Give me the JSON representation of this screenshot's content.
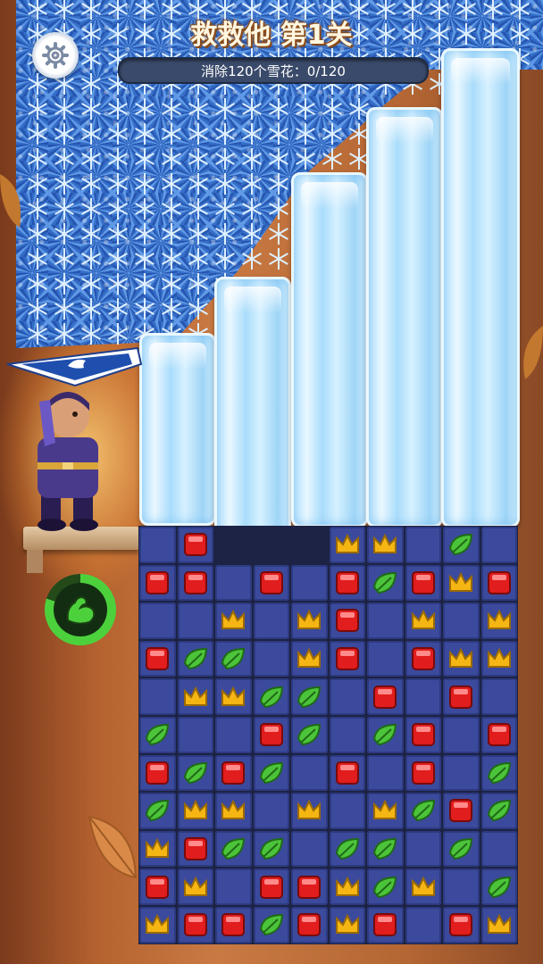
{
  "title": "救救他 第1关",
  "goal": {
    "label": "消除120个雪花",
    "progress": "：0/120",
    "collected": 0,
    "target": 120
  },
  "icons": {
    "settings": "gear-icon",
    "power": "flexed-arm-icon"
  },
  "ice_pillars": 5,
  "power_meter": {
    "fill_fraction": 0.8
  },
  "colors": {
    "red": "#e11d1d",
    "gold": "#f5b614",
    "green": "#4cc43a",
    "tile": "#3b4a9c"
  },
  "board": {
    "rows": [
      [
        "B",
        "R",
        "_",
        "_",
        "_",
        "C",
        "C",
        "B",
        "G",
        "B"
      ],
      [
        "R",
        "R",
        "B",
        "R",
        "B",
        "R",
        "G",
        "R",
        "C",
        "R"
      ],
      [
        "B",
        "B",
        "C",
        "B",
        "C",
        "R",
        "B",
        "C",
        "B",
        "C"
      ],
      [
        "R",
        "G",
        "G",
        "B",
        "C",
        "R",
        "B",
        "R",
        "C",
        "C"
      ],
      [
        "B",
        "C",
        "C",
        "G",
        "G",
        "B",
        "R",
        "B",
        "R",
        "B"
      ],
      [
        "G",
        "B",
        "B",
        "R",
        "G",
        "B",
        "G",
        "R",
        "B",
        "R"
      ],
      [
        "R",
        "G",
        "R",
        "G",
        "B",
        "R",
        "B",
        "R",
        "B",
        "G"
      ],
      [
        "G",
        "C",
        "C",
        "B",
        "C",
        "B",
        "C",
        "G",
        "R",
        "G"
      ],
      [
        "C",
        "R",
        "G",
        "G",
        "B",
        "G",
        "G",
        "B",
        "G",
        "B"
      ],
      [
        "R",
        "C",
        "B",
        "R",
        "R",
        "C",
        "G",
        "C",
        "B",
        "G"
      ],
      [
        "C",
        "R",
        "R",
        "G",
        "R",
        "C",
        "R",
        "B",
        "R",
        "C"
      ]
    ]
  }
}
